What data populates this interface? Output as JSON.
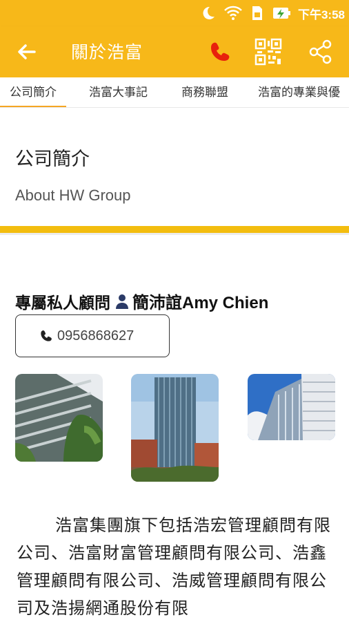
{
  "status_bar": {
    "time": "下午3:58"
  },
  "app_bar": {
    "title": "關於浩富"
  },
  "tabs": [
    {
      "label": "公司簡介"
    },
    {
      "label": "浩富大事記"
    },
    {
      "label": "商務聯盟"
    },
    {
      "label": "浩富的專業與優"
    }
  ],
  "section": {
    "title": "公司簡介",
    "subtitle": "About HW Group"
  },
  "advisor": {
    "label": "專屬私人顧問",
    "name": "簡沛誼Amy Chien",
    "phone": "0956868627"
  },
  "photos": [
    {
      "icon": "building-photo-1"
    },
    {
      "icon": "building-photo-2"
    },
    {
      "icon": "building-photo-3"
    }
  ],
  "intro": "浩富集團旗下包括浩宏管理顧問有限公司、浩富財富管理顧問有限公司、浩鑫管理顧問有限公司、浩威管理顧問有限公司及浩揚網通股份有限",
  "colors": {
    "accent": "#f7b819",
    "divider": "#f3bd0f",
    "phone_icon": "#e8200c"
  }
}
